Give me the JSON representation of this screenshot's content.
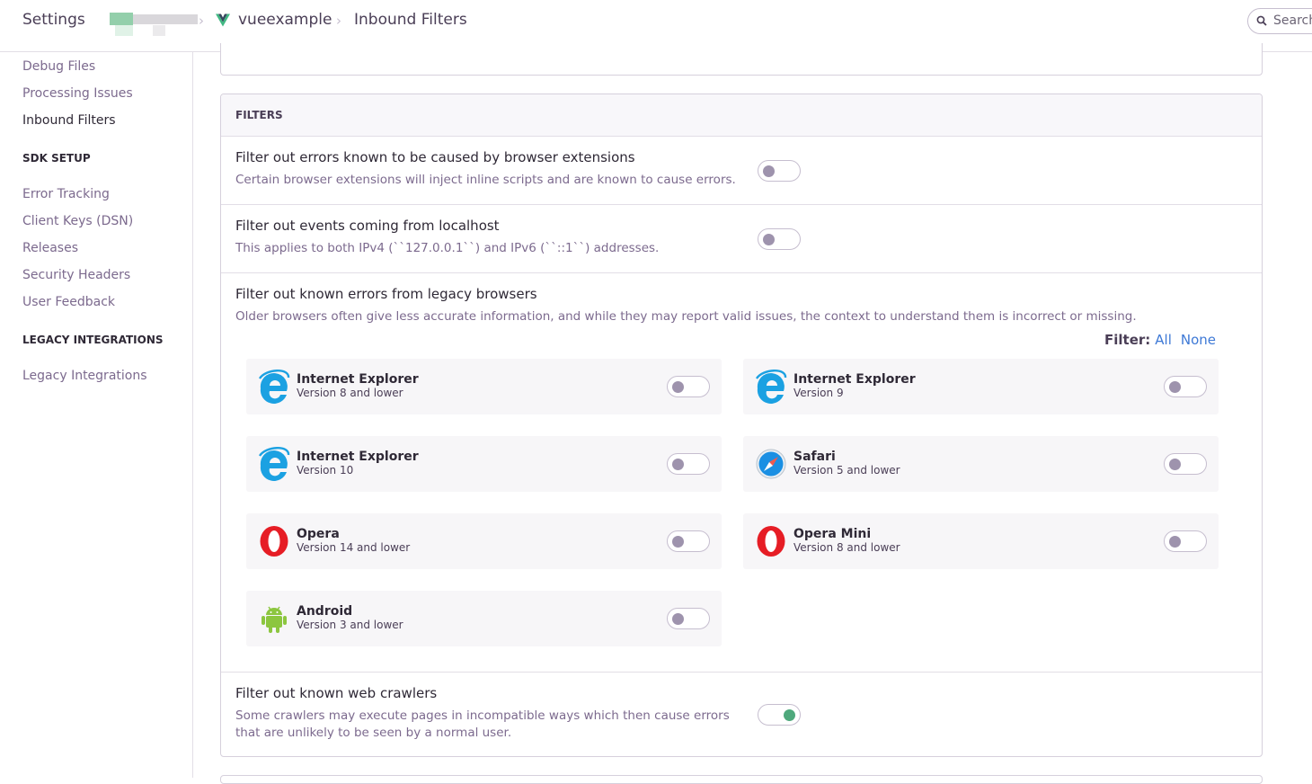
{
  "header": {
    "settings_label": "Settings",
    "project_name": "vueexample",
    "page_name": "Inbound Filters",
    "search_placeholder": "Search"
  },
  "sidebar": {
    "items_top": [
      {
        "label": "Debug Files"
      },
      {
        "label": "Processing Issues"
      },
      {
        "label": "Inbound Filters",
        "active": true
      }
    ],
    "sdk_heading": "SDK SETUP",
    "sdk_items": [
      {
        "label": "Error Tracking"
      },
      {
        "label": "Client Keys (DSN)"
      },
      {
        "label": "Releases"
      },
      {
        "label": "Security Headers"
      },
      {
        "label": "User Feedback"
      }
    ],
    "legacy_heading": "LEGACY INTEGRATIONS",
    "legacy_items": [
      {
        "label": "Legacy Integrations"
      }
    ]
  },
  "filters": {
    "heading": "FILTERS",
    "browser_extensions": {
      "title": "Filter out errors known to be caused by browser extensions",
      "description": "Certain browser extensions will inject inline scripts and are known to cause errors.",
      "enabled": false
    },
    "localhost": {
      "title": "Filter out events coming from localhost",
      "description": "This applies to both IPv4 (``127.0.0.1``) and IPv6 (``::1``) addresses.",
      "enabled": false
    },
    "legacy_browsers": {
      "title": "Filter out known errors from legacy browsers",
      "description": "Older browsers often give less accurate information, and while they may report valid issues, the context to understand them is incorrect or missing.",
      "filter_label": "Filter:",
      "all_label": "All",
      "none_label": "None",
      "browsers": [
        {
          "name": "Internet Explorer",
          "version": "Version 8 and lower",
          "icon": "ie-icon",
          "enabled": false
        },
        {
          "name": "Internet Explorer",
          "version": "Version 9",
          "icon": "ie-icon",
          "enabled": false
        },
        {
          "name": "Internet Explorer",
          "version": "Version 10",
          "icon": "ie-icon",
          "enabled": false
        },
        {
          "name": "Safari",
          "version": "Version 5 and lower",
          "icon": "safari-icon",
          "enabled": false
        },
        {
          "name": "Opera",
          "version": "Version 14 and lower",
          "icon": "opera-icon",
          "enabled": false
        },
        {
          "name": "Opera Mini",
          "version": "Version 8 and lower",
          "icon": "opera-icon",
          "enabled": false
        },
        {
          "name": "Android",
          "version": "Version 3 and lower",
          "icon": "android-icon",
          "enabled": false
        }
      ]
    },
    "web_crawlers": {
      "title": "Filter out known web crawlers",
      "description": "Some crawlers may execute pages in incompatible ways which then cause errors that are unlikely to be seen by a normal user.",
      "enabled": true
    }
  },
  "colors": {
    "accent_link": "#3e79d6",
    "switch_on": "#4ea87c",
    "switch_off_knob": "#9e93ad"
  }
}
